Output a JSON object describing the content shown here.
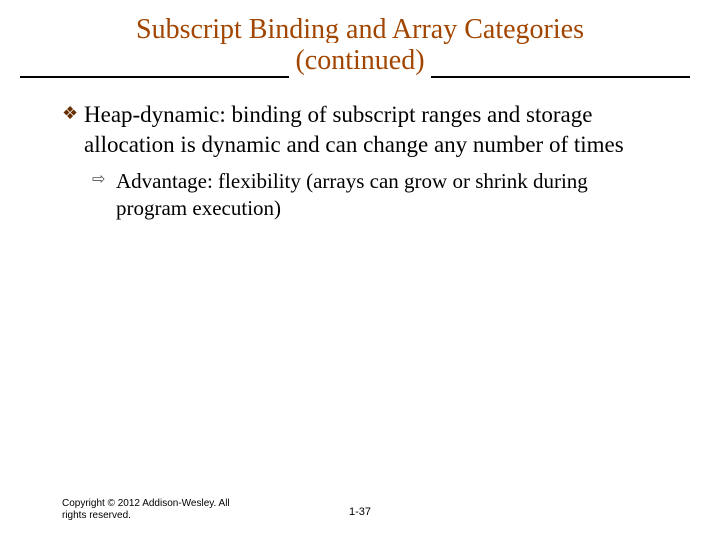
{
  "title_line1": "Subscript Binding and Array Categories",
  "title_line2": "(continued)",
  "bullets": {
    "lvl1_text": "Heap-dynamic: binding of subscript ranges and storage allocation is dynamic and can change any number of times",
    "lvl2_text": "Advantage: flexibility (arrays can grow or shrink during program execution)"
  },
  "footer": {
    "copyright": "Copyright © 2012 Addison-Wesley. All rights reserved.",
    "page": "1-37"
  }
}
